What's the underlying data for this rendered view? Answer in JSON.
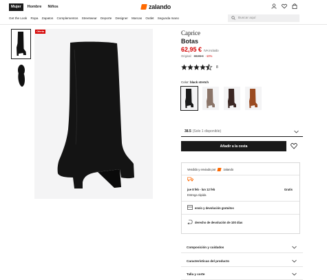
{
  "header": {
    "segments": [
      {
        "label": "Mujer",
        "active": true
      },
      {
        "label": "Hombre",
        "active": false
      },
      {
        "label": "Niños",
        "active": false
      }
    ],
    "logo_text": "zalando",
    "icons": [
      "account-icon",
      "wishlist-heart-icon",
      "bag-icon"
    ]
  },
  "nav": {
    "items": [
      "Get the Look",
      "Ropa",
      "Zapatos",
      "Complementos",
      "Streetwear",
      "Deporte",
      "Designer",
      "Marcas",
      "Outlet",
      "Segunda mano"
    ],
    "search_placeholder": "Buscar aquí"
  },
  "gallery": {
    "badge": "Oferta"
  },
  "product": {
    "brand": "Caprice",
    "name": "Botas",
    "price": "62,95 €",
    "vat_note": "IVA incluido",
    "original_label": "Original:",
    "original_price": "69,95 €",
    "discount": "-10%",
    "rating_stars": 4.5,
    "rating_count": "8",
    "color_label": "Color:",
    "color_value": "black stretch"
  },
  "size_selector": {
    "size": "38.5",
    "availability": "(Solo 1 disponible)"
  },
  "cart": {
    "add_label": "Añadir a la cesta"
  },
  "delivery": {
    "sold_by": "Vendido y enviado por",
    "seller": "zalando",
    "dates": "jue 8 feb - lun 12 feb",
    "cost": "Gratis",
    "speed": "Entrega rápida",
    "shipping_returns": "envío y devolución gratuitos",
    "return_right": "derecho de devolución de 100 días"
  },
  "accordions": [
    {
      "label": "Composición y cuidados"
    },
    {
      "label": "Características del producto"
    },
    {
      "label": "Talla y corte"
    }
  ],
  "colors": {
    "accent": "#ff6900",
    "sale": "#d40000",
    "swatch_colors": [
      "#1a1a1a",
      "#8a7468",
      "#3a2622",
      "#9a4a20"
    ]
  }
}
